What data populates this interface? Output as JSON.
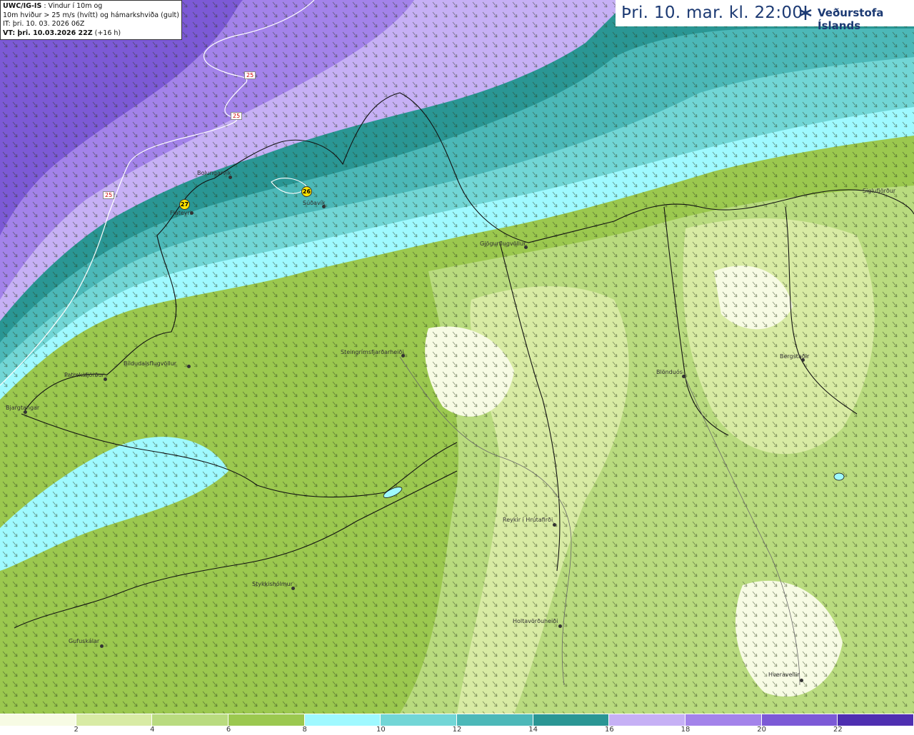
{
  "header": {
    "product_code": "UWC/IG-IS",
    "description_line1": " : Vindur í 10m og",
    "description_line2": "10m hviður > 25 m/s (hvítt) og hámarkshviða (gult)",
    "issue_time": "IT: þri. 10. 03. 2026 06Z",
    "valid_label": "VT: þri. 10.03.2026 22Z",
    "valid_offset": " (+16 h)"
  },
  "time_banner": {
    "text": "Þri. 10. mar. kl. 22:00"
  },
  "brand": {
    "name": "Veðurstofa Íslands",
    "color": "#1c3a73"
  },
  "legend": {
    "colors": [
      "#f7fbe4",
      "#d8eba4",
      "#b9db7f",
      "#9bc84f",
      "#9ff9ff",
      "#72d6d6",
      "#4cb8b8",
      "#2a9694",
      "#c6b0f5",
      "#a383ea",
      "#7c5ad6",
      "#4e2fb0"
    ],
    "ticks": [
      "2",
      "4",
      "6",
      "8",
      "10",
      "12",
      "14",
      "16",
      "18",
      "20",
      "22"
    ]
  },
  "places": [
    {
      "name": "Bolungarvík"
    },
    {
      "name": "Flateyri"
    },
    {
      "name": "Súðavík"
    },
    {
      "name": "Gjögurflugvöllur"
    },
    {
      "name": "Siglufjörður"
    },
    {
      "name": "Steingrímsfjarðarheiði"
    },
    {
      "name": "Bíldudalsflugvöllur"
    },
    {
      "name": "Patreksfjörður"
    },
    {
      "name": "Bjargtangar"
    },
    {
      "name": "Blönduós"
    },
    {
      "name": "Bergstaðir"
    },
    {
      "name": "Reykir í Hrútafirði"
    },
    {
      "name": "Stykkishólmur"
    },
    {
      "name": "Gufuskálar"
    },
    {
      "name": "Holtavörðuheiði"
    },
    {
      "name": "Hveravellir"
    }
  ],
  "gust_markers": [
    {
      "value": "27"
    },
    {
      "value": "26"
    }
  ],
  "isoline_labels": [
    "25",
    "25",
    "25"
  ]
}
